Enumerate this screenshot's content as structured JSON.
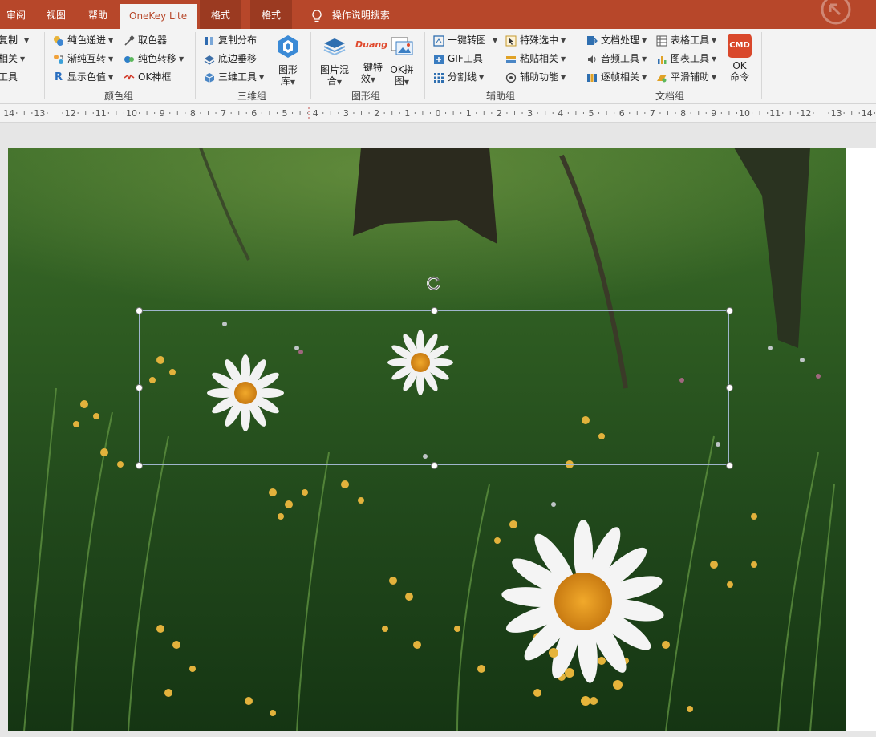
{
  "tabs": {
    "review": "审阅",
    "view": "视图",
    "help": "帮助",
    "onekey": "OneKey Lite",
    "format1": "格式",
    "format2": "格式"
  },
  "search": {
    "label": "操作说明搜索"
  },
  "ribbon": {
    "copy": {
      "left": [
        "复制",
        "相关",
        "工具"
      ]
    },
    "color": {
      "label": "颜色组",
      "items": [
        "纯色递进",
        "取色器",
        "渐纯互转",
        "纯色转移",
        "显示色值",
        "OK神框"
      ]
    },
    "three_d": {
      "label": "三维组",
      "items": [
        "复制分布",
        "底边垂移",
        "三维工具"
      ],
      "big": [
        "图形",
        "库"
      ]
    },
    "shape": {
      "label": "图形组",
      "big": [
        {
          "line1": "图片混",
          "line2": "合"
        },
        {
          "line1": "一键特",
          "line2": "效",
          "art": "Duang"
        },
        {
          "line1": "OK拼",
          "line2": "图"
        }
      ]
    },
    "assist": {
      "label": "辅助组",
      "items": [
        "一键转图",
        "特殊选中",
        "GIF工具",
        "粘贴相关",
        "分割线",
        "辅助功能"
      ]
    },
    "doc": {
      "label": "文档组",
      "items": [
        "文档处理",
        "表格工具",
        "音频工具",
        "图表工具",
        "逐帧相关",
        "平滑辅助"
      ],
      "cmd_badge": "CMD",
      "cmd": [
        "OK",
        "命令"
      ]
    }
  },
  "ruler": {
    "ticks": [
      "14",
      "13",
      "12",
      "11",
      "10",
      "9",
      "8",
      "7",
      "6",
      "5",
      "4",
      "3",
      "2",
      "1",
      "0",
      "1",
      "2",
      "3",
      "4",
      "5",
      "6",
      "7",
      "8",
      "9",
      "10",
      "11",
      "12",
      "13",
      "14"
    ]
  },
  "colors": {
    "accent": "#b7472a",
    "ribbon_bg": "#f3f3f3",
    "selection": "#9fb5cc"
  }
}
